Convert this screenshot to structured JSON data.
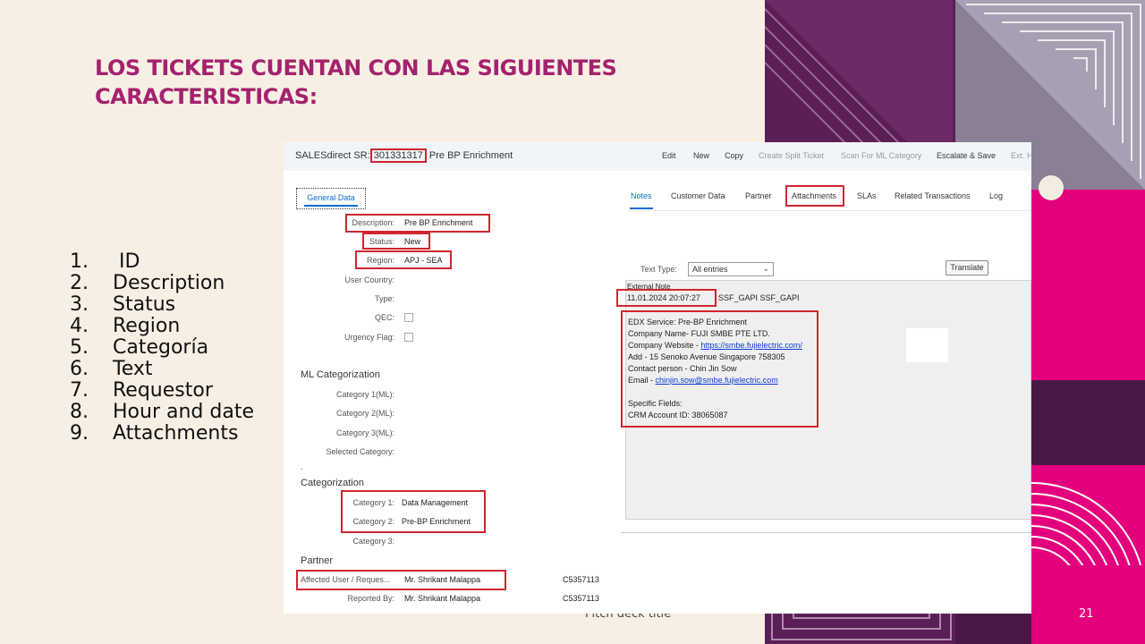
{
  "slide": {
    "title": "LOS TICKETS CUENTAN CON LAS SIGUIENTES CARACTERISTICAS:",
    "list": [
      {
        "num": "1.",
        "text": " ID"
      },
      {
        "num": "2.",
        "text": "Description"
      },
      {
        "num": "3.",
        "text": "Status"
      },
      {
        "num": "4.",
        "text": "Region"
      },
      {
        "num": "5.",
        "text": "Categoría"
      },
      {
        "num": "6.",
        "text": "Text"
      },
      {
        "num": "7.",
        "text": "Requestor"
      },
      {
        "num": "8.",
        "text": "Hour and date"
      },
      {
        "num": "9.",
        "text": "Attachments"
      }
    ],
    "footer_title": "Pitch deck title",
    "page_number": "21",
    "colors": {
      "title": "#a3226e",
      "highlight": "#d0262f",
      "background": "#f7efe4",
      "magenta": "#e4007c",
      "purple": "#5a1f56"
    }
  },
  "app": {
    "header": {
      "prefix": "SALESdirect SR:",
      "id": "301331317",
      "suffix": "Pre BP Enrichment"
    },
    "actions": [
      "Edit",
      "New",
      "Copy",
      "Create Split Ticket",
      "Scan For ML Category",
      "Escalate & Save",
      "Ext. H"
    ],
    "left_tab": "General Data",
    "fields": {
      "description": {
        "label": "Description:",
        "value": "Pre BP Enrichment"
      },
      "status": {
        "label": "Status:",
        "value": "New"
      },
      "region": {
        "label": "Region:",
        "value": "APJ - SEA"
      },
      "user_country": {
        "label": "User Country:"
      },
      "type": {
        "label": "Type:"
      },
      "qec": {
        "label": "QEC:"
      },
      "urgency": {
        "label": "Urgency Flag:"
      }
    },
    "ml_section": {
      "title": "ML Categorization",
      "labels": [
        "Category 1(ML):",
        "Category 2(ML):",
        "Category 3(ML):",
        "Selected Category:"
      ],
      "dot": "."
    },
    "cat_section": {
      "title": "Categorization",
      "items": [
        {
          "label": "Category 1:",
          "value": "Data Management"
        },
        {
          "label": "Category 2:",
          "value": "Pre-BP Enrichment"
        },
        {
          "label": "Category 3:",
          "value": ""
        }
      ]
    },
    "partner_section": {
      "title": "Partner",
      "rows": [
        {
          "label": "Affected User / Reques...",
          "name": "Mr. Shrikant Malappa",
          "id": "C5357113"
        },
        {
          "label": "Reported By:",
          "name": "Mr. Shrikant Malappa",
          "id": "C5357113"
        }
      ]
    },
    "right_tabs": [
      "Notes",
      "Customer Data",
      "Partner",
      "Attachments",
      "SLAs",
      "Related Transactions",
      "Log"
    ],
    "text_type": {
      "label": "Text Type:",
      "value": "All entries"
    },
    "translate_label": "Translate",
    "external_note": {
      "label": "External Note",
      "datetime": "11.01.2024   20:07:27",
      "author": "SSF_GAPI SSF_GAPI",
      "lines": {
        "l1": "EDX Service: Pre-BP Enrichment",
        "l2": "Company Name- FUJI SMBE PTE LTD.",
        "l3_prefix": "Company Website - ",
        "l3_link": "https://smbe.fujielectric.com/",
        "l4": "Add - 15 Senoko Avenue Singapore 758305",
        "l5": "Contact person - Chin Jin Sow",
        "l6_prefix": "Email - ",
        "l6_link": "chinjin.sow@smbe.fujielectric.com",
        "l7": "Specific Fields:",
        "l8": "CRM Account ID: 38065087"
      }
    }
  }
}
